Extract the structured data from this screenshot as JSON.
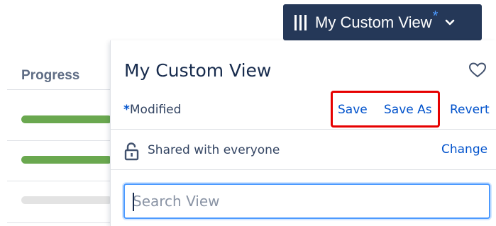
{
  "table": {
    "progress_header": "Progress",
    "rows": [
      {
        "progress": 1.0,
        "color": "#6aa84f"
      },
      {
        "progress": 1.0,
        "color": "#6aa84f"
      },
      {
        "progress": 0.0,
        "color": "#e3e3e3"
      }
    ]
  },
  "view_button": {
    "label": "My Custom View",
    "modified_marker": "*",
    "icon": "columns-icon",
    "chevron": "chevron-down-icon",
    "background": "#253858"
  },
  "panel": {
    "title": "My Custom View",
    "favorite_icon": "heart-icon",
    "modified_marker": "*",
    "modified_label": "Modified",
    "actions": {
      "save": "Save",
      "save_as": "Save As",
      "revert": "Revert"
    },
    "sharing": {
      "icon": "lock-open-icon",
      "label": "Shared with everyone",
      "change": "Change"
    },
    "search": {
      "placeholder": "Search View",
      "value": ""
    }
  },
  "colors": {
    "link": "#0052cc",
    "highlight": "#e60000",
    "focus": "#4c9aff"
  }
}
